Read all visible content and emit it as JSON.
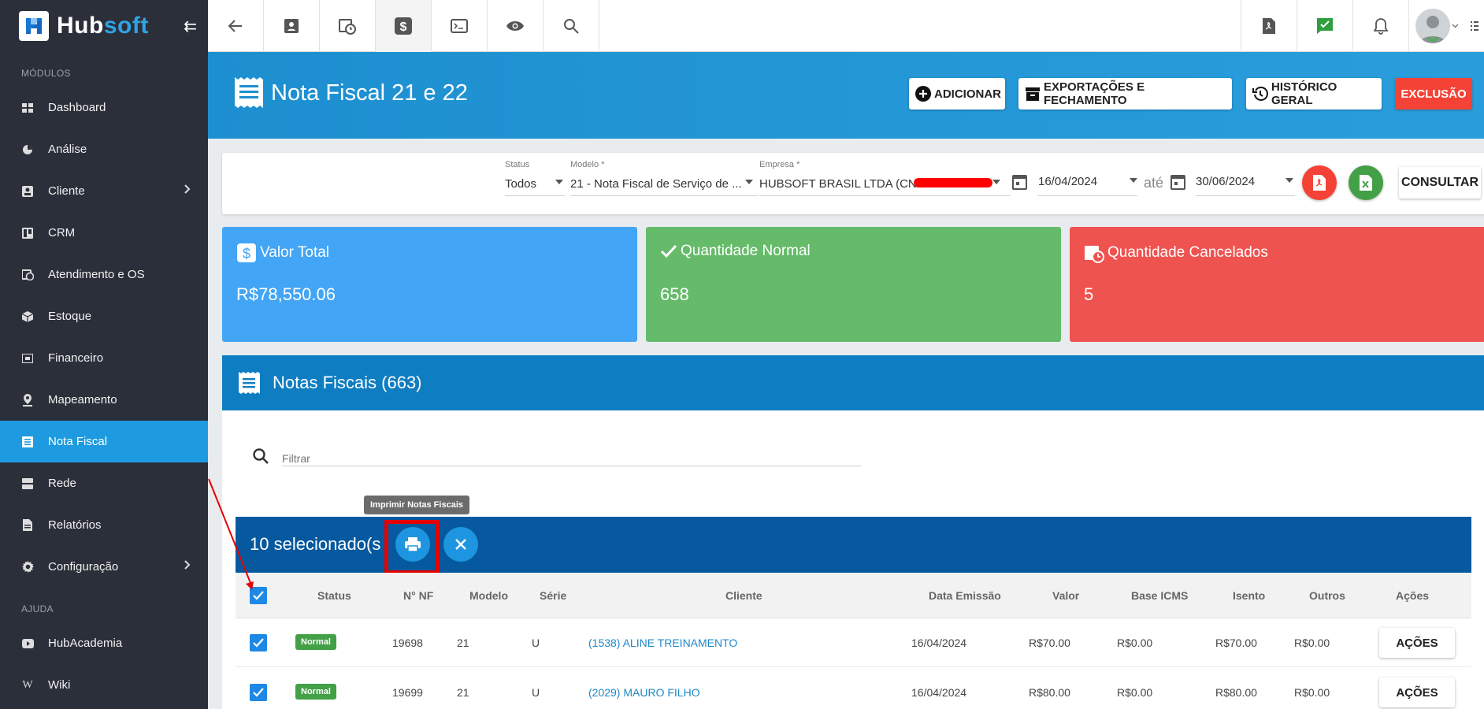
{
  "brand": {
    "hub": "Hub",
    "soft": "soft",
    "collapse_icon": "collapse-icon"
  },
  "sidebar": {
    "section_modules": "MÓDULOS",
    "section_help": "AJUDA",
    "items": [
      {
        "label": "Dashboard",
        "icon": "dashboard-icon"
      },
      {
        "label": "Análise",
        "icon": "pie-chart-icon"
      },
      {
        "label": "Cliente",
        "icon": "contact-card-icon"
      },
      {
        "label": "CRM",
        "icon": "crm-board-icon"
      },
      {
        "label": "Atendimento e OS",
        "icon": "calendar-clock-icon"
      },
      {
        "label": "Estoque",
        "icon": "box-icon"
      },
      {
        "label": "Financeiro",
        "icon": "money-icon"
      },
      {
        "label": "Mapeamento",
        "icon": "map-pin-icon"
      },
      {
        "label": "Nota Fiscal",
        "icon": "receipt-icon"
      },
      {
        "label": "Rede",
        "icon": "server-icon"
      },
      {
        "label": "Relatórios",
        "icon": "report-icon"
      },
      {
        "label": "Configuração",
        "icon": "gear-icon"
      }
    ],
    "help_items": [
      {
        "label": "HubAcademia",
        "icon": "play-icon"
      },
      {
        "label": "Wiki",
        "icon": "wiki-icon"
      }
    ]
  },
  "page": {
    "title": "Nota Fiscal 21 e 22",
    "buttons": {
      "add": "ADICIONAR",
      "export": "EXPORTAÇÕES E FECHAMENTO",
      "history": "HISTÓRICO GERAL",
      "exclusion": "EXCLUSÃO"
    }
  },
  "filters": {
    "status_label": "Status",
    "status_value": "Todos",
    "model_label": "Modelo *",
    "model_value": "21 - Nota Fiscal de Serviço de ...",
    "company_label": "Empresa *",
    "company_value": "HUBSOFT BRASIL LTDA (CNPJ:",
    "date_from": "16/04/2024",
    "ate": "até",
    "date_to": "30/06/2024",
    "consultar": "CONSULTAR"
  },
  "stats": {
    "total_label": "Valor Total",
    "total_value": "R$78,550.06",
    "normal_label": "Quantidade Normal",
    "normal_value": "658",
    "canceled_label": "Quantidade Cancelados",
    "canceled_value": "5"
  },
  "table": {
    "title": "Notas Fiscais (663)",
    "filter_placeholder": "Filtrar",
    "tooltip": "Imprimir Notas Fiscais",
    "selected_text": "10 selecionado(s",
    "columns": [
      "Status",
      "N° NF",
      "Modelo",
      "Série",
      "Cliente",
      "Data Emissão",
      "Valor",
      "Base ICMS",
      "Isento",
      "Outros",
      "Ações"
    ],
    "rows": [
      {
        "status": "Normal",
        "nf": "19698",
        "modelo": "21",
        "serie": "U",
        "cliente": "(1538) ALINE TREINAMENTO",
        "data": "16/04/2024",
        "valor": "R$70.00",
        "base": "R$0.00",
        "isento": "R$70.00",
        "outros": "R$0.00",
        "acoes": "AÇÕES"
      },
      {
        "status": "Normal",
        "nf": "19699",
        "modelo": "21",
        "serie": "U",
        "cliente": "(2029) MAURO FILHO",
        "data": "16/04/2024",
        "valor": "R$80.00",
        "base": "R$0.00",
        "isento": "R$80.00",
        "outros": "R$0.00",
        "acoes": "AÇÕES"
      }
    ]
  },
  "colors": {
    "sidebar_bg": "#2b2f3a",
    "active": "#1e9be0",
    "header": "#1d8fd0",
    "blue_card": "#42a5f5",
    "green_card": "#66bb6a",
    "red_card": "#ef5350",
    "table_header": "#0f7dc2",
    "selection_bar": "#06599e",
    "highlight_frame": "#e60000"
  }
}
